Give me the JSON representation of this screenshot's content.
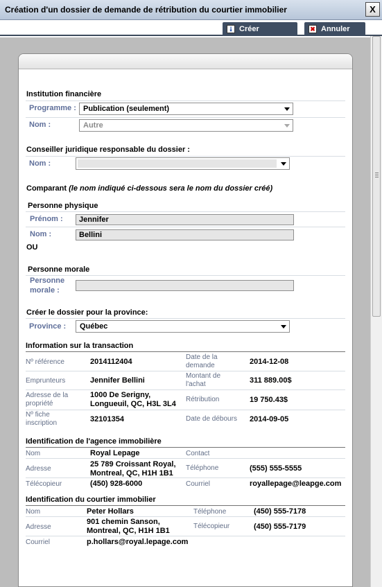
{
  "window": {
    "title": "Création d'un dossier de demande de rétribution du courtier immobilier",
    "close_label": "X"
  },
  "toolbar": {
    "create_label": "Créer",
    "cancel_label": "Annuler"
  },
  "icons": {
    "create": "download-icon",
    "cancel": "cancel-x-icon"
  },
  "institution": {
    "section_title": "Institution financière",
    "programme_label": "Programme :",
    "programme_value": "Publication (seulement)",
    "nom_label": "Nom :",
    "nom_value": "Autre"
  },
  "conseiller": {
    "section_title": "Conseiller juridique responsable du dossier :",
    "nom_label": "Nom :",
    "nom_value": ""
  },
  "comparant": {
    "title_main": "Comparant ",
    "title_note": "(le nom indiqué ci-dessous sera le nom du dossier créé)",
    "physique_title": "Personne physique",
    "prenom_label": "Prénom :",
    "prenom_value": "Jennifer",
    "nom_label": "Nom :",
    "nom_value": "Bellini",
    "ou": "OU",
    "morale_title": "Personne morale",
    "morale_label_1": "Personne",
    "morale_label_2": "morale :",
    "morale_value": ""
  },
  "province": {
    "section_title": "Créer le dossier pour la province:",
    "label": "Province :",
    "value": "Québec"
  },
  "transaction": {
    "section_title": "Information sur la transaction",
    "reference_label": "Nº référence",
    "reference_value": "2014112404",
    "date_demande_label_1": "Date de la",
    "date_demande_label_2": "demande",
    "date_demande_value": "2014-12-08",
    "emprunteurs_label": "Emprunteurs",
    "emprunteurs_value": "Jennifer Bellini",
    "montant_label_1": "Montant de",
    "montant_label_2": "l'achat",
    "montant_value": "311 889.00$",
    "adresse_label_1": "Adresse de la",
    "adresse_label_2": "propriété",
    "adresse_value_1": "1000 De Serigny,",
    "adresse_value_2": "Longueuil, QC, H3L 3L4",
    "retribution_label": "Rétribution",
    "retribution_value": "19 750.43$",
    "fiche_label_1": "Nº fiche",
    "fiche_label_2": "inscription",
    "fiche_value": "32101354",
    "date_debours_label": "Date de débours",
    "date_debours_value": "2014-09-05"
  },
  "agence": {
    "section_title": "Identification de l'agence immobilière",
    "nom_label": "Nom",
    "nom_value": "Royal Lepage",
    "contact_label": "Contact",
    "contact_value": "",
    "adresse_label": "Adresse",
    "adresse_value_1": "25 789 Croissant Royal,",
    "adresse_value_2": "Montreal, QC, H1H 1B1",
    "telephone_label": "Téléphone",
    "telephone_value": "(555) 555-5555",
    "telecopieur_label": "Télécopieur",
    "telecopieur_value": "(450) 928-6000",
    "courriel_label": "Courriel",
    "courriel_value": "royallepage@leapge.com"
  },
  "courtier": {
    "section_title": "Identification du courtier immobilier",
    "nom_label": "Nom",
    "nom_value": "Peter Hollars",
    "telephone_label": "Téléphone",
    "telephone_value": "(450) 555-7178",
    "adresse_label": "Adresse",
    "adresse_value_1": "901 chemin Sanson,",
    "adresse_value_2": "Montreal, QC, H1H 1B1",
    "telecopieur_label": "Télécopieur",
    "telecopieur_value": "(450) 555-7179",
    "courriel_label": "Courriel",
    "courriel_value": "p.hollars@royal.lepage.com"
  }
}
